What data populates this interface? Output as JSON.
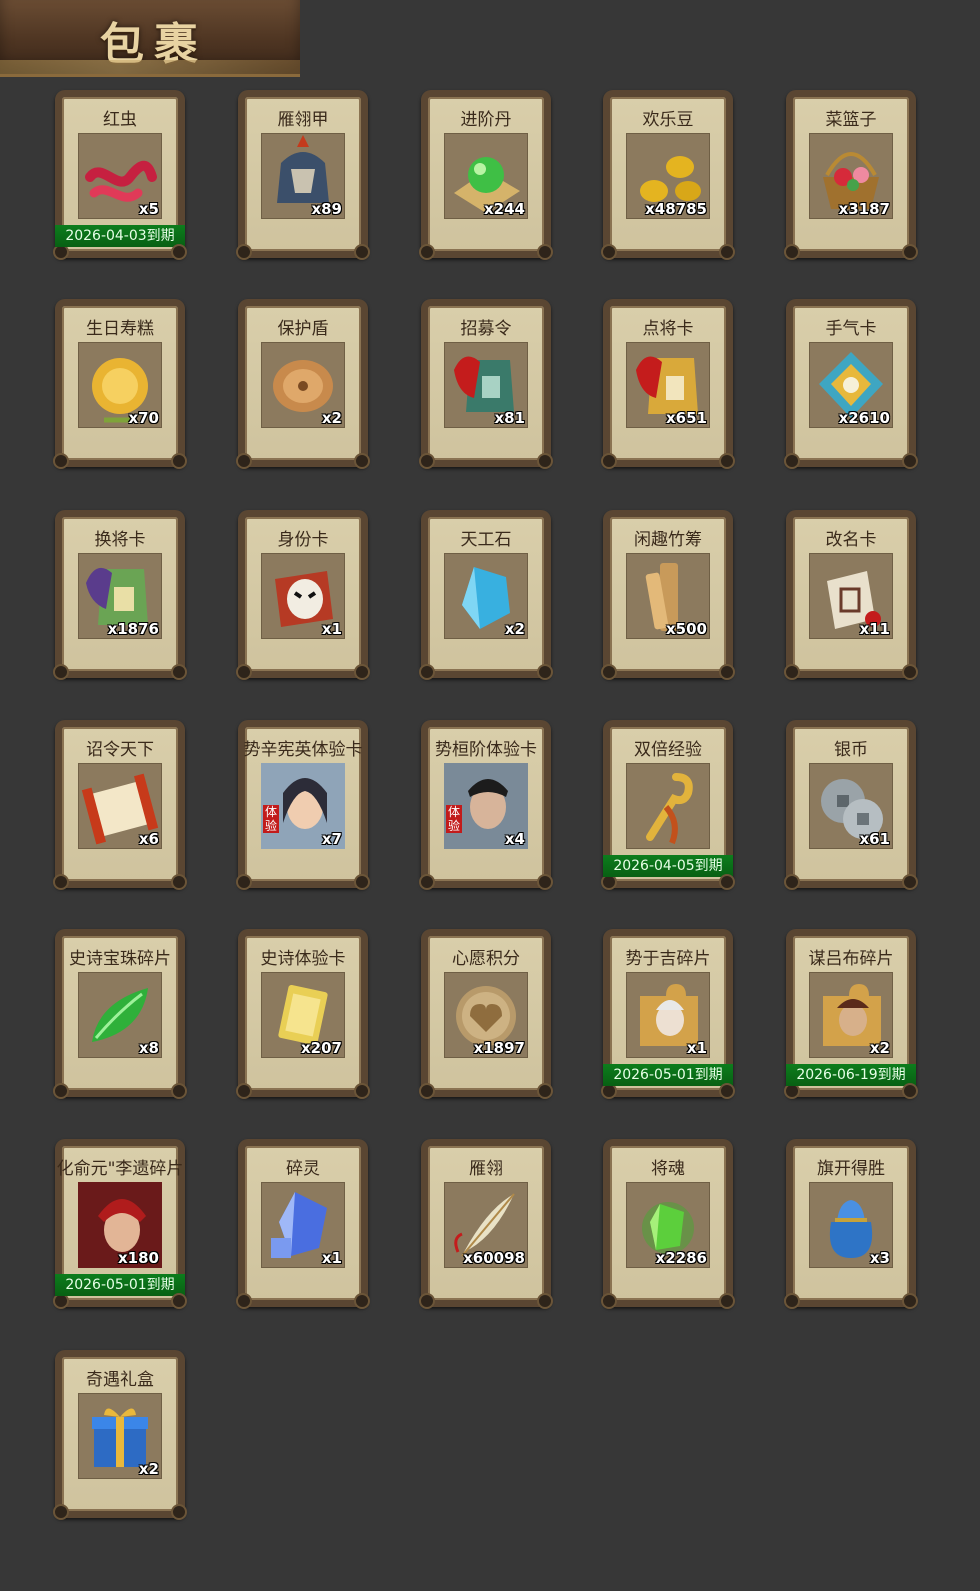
{
  "header": {
    "title": "包裹"
  },
  "items": [
    {
      "name": "红虫",
      "qty": "x5",
      "icon": "red-worm-icon",
      "expiry": "2026-04-03到期"
    },
    {
      "name": "雁翎甲",
      "qty": "x89",
      "icon": "helmet-armor-icon"
    },
    {
      "name": "进阶丹",
      "qty": "x244",
      "icon": "green-orb-icon"
    },
    {
      "name": "欢乐豆",
      "qty": "x48785",
      "icon": "gold-beans-icon"
    },
    {
      "name": "菜篮子",
      "qty": "x3187",
      "icon": "flower-basket-icon"
    },
    {
      "name": "生日寿糕",
      "qty": "x70",
      "icon": "mooncake-icon"
    },
    {
      "name": "保护盾",
      "qty": "x2",
      "icon": "round-shield-icon"
    },
    {
      "name": "招募令",
      "qty": "x81",
      "icon": "recruit-token-icon"
    },
    {
      "name": "点将卡",
      "qty": "x651",
      "icon": "general-card-icon"
    },
    {
      "name": "手气卡",
      "qty": "x2610",
      "icon": "luck-card-icon"
    },
    {
      "name": "换将卡",
      "qty": "x1876",
      "icon": "swap-general-card-icon"
    },
    {
      "name": "身份卡",
      "qty": "x1",
      "icon": "opera-mask-card-icon"
    },
    {
      "name": "天工石",
      "qty": "x2",
      "icon": "blue-crystal-icon"
    },
    {
      "name": "闲趣竹筹",
      "qty": "x500",
      "icon": "bamboo-tally-icon"
    },
    {
      "name": "改名卡",
      "qty": "x11",
      "icon": "rename-card-icon"
    },
    {
      "name": "诏令天下",
      "qty": "x6",
      "icon": "edict-scroll-icon"
    },
    {
      "name": "势辛宪英体验卡",
      "qty": "x7",
      "icon": "heroine-portrait-icon",
      "badge": "体验"
    },
    {
      "name": "势桓阶体验卡",
      "qty": "x4",
      "icon": "hero-portrait-icon",
      "badge": "体验"
    },
    {
      "name": "双倍经验",
      "qty": "",
      "icon": "golden-ruyi-icon",
      "expiry": "2026-04-05到期"
    },
    {
      "name": "银币",
      "qty": "x61",
      "icon": "silver-coins-icon"
    },
    {
      "name": "史诗宝珠碎片",
      "qty": "x8",
      "icon": "green-leaf-shard-icon"
    },
    {
      "name": "史诗体验卡",
      "qty": "x207",
      "icon": "gold-card-icon"
    },
    {
      "name": "心愿积分",
      "qty": "x1897",
      "icon": "heart-coin-icon"
    },
    {
      "name": "势于吉碎片",
      "qty": "x1",
      "icon": "puzzle-portrait-icon",
      "expiry": "2026-05-01到期"
    },
    {
      "name": "谋吕布碎片",
      "qty": "x2",
      "icon": "puzzle-warrior-icon",
      "expiry": "2026-06-19到期"
    },
    {
      "name": "化俞元\"李遗碎片",
      "qty": "x180",
      "icon": "red-warrior-portrait-icon",
      "expiry": "2026-05-01到期"
    },
    {
      "name": "碎灵",
      "qty": "x1",
      "icon": "crystal-puzzle-icon"
    },
    {
      "name": "雁翎",
      "qty": "x60098",
      "icon": "feather-icon"
    },
    {
      "name": "将魂",
      "qty": "x2286",
      "icon": "green-soul-crystal-icon"
    },
    {
      "name": "旗开得胜",
      "qty": "x3",
      "icon": "blue-pouch-icon"
    },
    {
      "name": "奇遇礼盒",
      "qty": "x2",
      "icon": "gift-box-icon"
    }
  ],
  "colors": {
    "background": "#373737",
    "card_face": "#d4c8a3",
    "card_frame": "#5a4632",
    "expiry_bar": "#0b711a"
  }
}
